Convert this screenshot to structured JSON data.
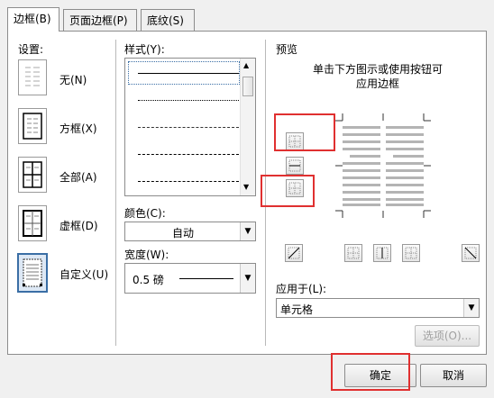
{
  "tabs": [
    {
      "label": "边框(B)",
      "active": true
    },
    {
      "label": "页面边框(P)",
      "active": false
    },
    {
      "label": "底纹(S)",
      "active": false
    }
  ],
  "settings": {
    "heading": "设置:",
    "items": [
      {
        "label": "无(N)",
        "icon": "no-border-icon"
      },
      {
        "label": "方框(X)",
        "icon": "box-border-icon"
      },
      {
        "label": "全部(A)",
        "icon": "all-borders-icon"
      },
      {
        "label": "虚框(D)",
        "icon": "grid-border-icon"
      },
      {
        "label": "自定义(U)",
        "icon": "custom-border-icon",
        "selected": true
      }
    ]
  },
  "style": {
    "heading": "样式(Y):",
    "line_styles": [
      "solid",
      "dotted",
      "dashed-fine",
      "dashed",
      "dash-dot"
    ],
    "color_label": "颜色(C):",
    "color_value": "自动",
    "width_label": "宽度(W):",
    "width_value": "0.5 磅"
  },
  "preview": {
    "heading": "预览",
    "hint_line1": "单击下方图示或使用按钮可",
    "hint_line2": "应用边框",
    "apply_to_label": "应用于(L):",
    "apply_to_value": "单元格",
    "options_button": "选项(O)..."
  },
  "footer": {
    "ok": "确定",
    "cancel": "取消"
  },
  "colors": {
    "highlight": "#e03030",
    "selected_border": "#3a6ea5"
  }
}
